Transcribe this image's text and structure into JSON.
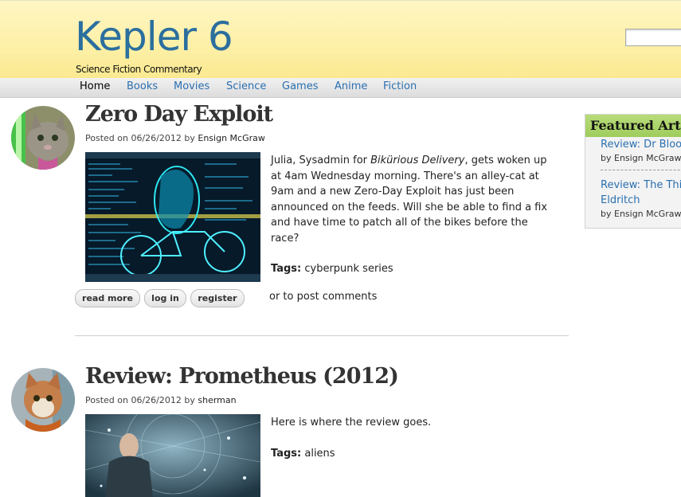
{
  "site": {
    "title": "Kepler 6",
    "slogan": "Science Fiction Commentary",
    "search_placeholder": ""
  },
  "nav": {
    "items": [
      "Home",
      "Books",
      "Movies",
      "Science",
      "Games",
      "Anime",
      "Fiction"
    ],
    "active": "Home"
  },
  "posts": [
    {
      "title": "Zero Day Exploit",
      "posted_on_label": "Posted on",
      "date": "06/26/2012",
      "by_label": "by",
      "author": "Ensign McGraw",
      "body_parts": [
        "Julia, Sysadmin for ",
        "Bikürious Delivery",
        ", gets woken up at 4am Wednesday morning. There's an alley-cat at 9am and a new Zero-Day Exploit has just been announced on the feeds. Will she be able to find a fix and have time to patch all of the bikes before the race?"
      ],
      "tags_label": "Tags:",
      "tags": "cyberpunk series",
      "buttons": [
        "read more",
        "log in",
        "register"
      ],
      "comment_note": "or to post comments"
    },
    {
      "title": "Review: Prometheus (2012)",
      "posted_on_label": "Posted on",
      "date": "06/26/2012",
      "by_label": "by",
      "author": "sherman",
      "body": "Here is where the review goes.",
      "tags_label": "Tags:",
      "tags": "aliens"
    }
  ],
  "featured": {
    "heading": "Featured Articles",
    "items": [
      {
        "title": "Review: Dr Bloodmoney",
        "author": "by Ensign McGraw"
      },
      {
        "title": "Review: The Thing",
        "title_line2": "Eldritch",
        "author": "by Ensign McGraw"
      }
    ]
  },
  "colors": {
    "link": "#2a6fb0",
    "site_title": "#2b6f9e",
    "header_bg": "#fdf0a6",
    "featured_header": "#a8d267"
  }
}
